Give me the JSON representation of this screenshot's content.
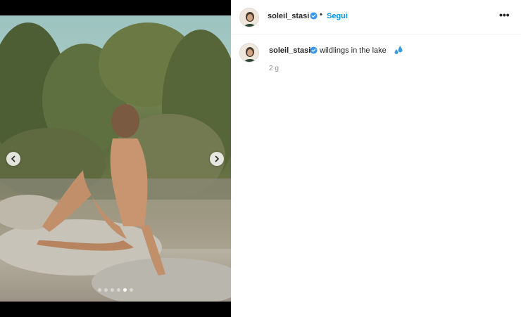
{
  "post": {
    "username": "soleil_stasi",
    "follow_separator": "•",
    "follow_label": "Segui",
    "more_label": "•••",
    "caption": "wildlings in the lake",
    "caption_emoji": "sweat-droplets-icon",
    "time_ago": "2 g"
  },
  "carousel": {
    "slides": 6,
    "active_index": 4
  },
  "colors": {
    "accent": "#0095f6",
    "verified": "#3897f0",
    "muted": "#8e8e8e"
  }
}
